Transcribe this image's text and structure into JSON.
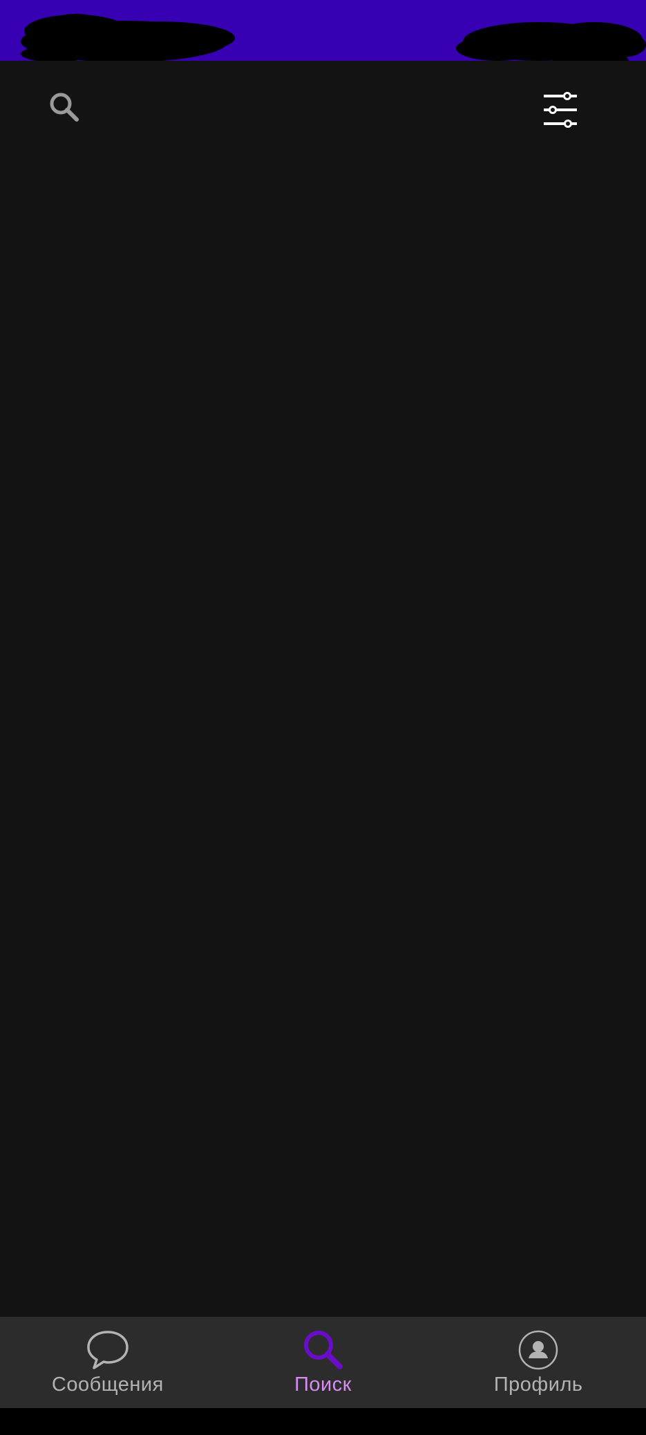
{
  "colors": {
    "status_bar": "#3700b3",
    "background": "#131313",
    "bottom_nav": "#2c2c2c",
    "system_bar": "#000000",
    "nav_inactive": "#b3b3b3",
    "nav_active_label": "#d68cf0",
    "nav_active_icon": "#6a0dc9",
    "toolbar_search_icon": "#9a9a9a",
    "toolbar_filter_icon": "#ffffff"
  },
  "toolbar": {
    "search_icon": "search-icon",
    "filter_icon": "sliders-icon"
  },
  "bottom_nav": {
    "items": [
      {
        "label": "Сообщения",
        "icon": "chat-bubble-icon",
        "active": false
      },
      {
        "label": "Поиск",
        "icon": "search-icon",
        "active": true
      },
      {
        "label": "Профиль",
        "icon": "profile-icon",
        "active": false
      }
    ]
  }
}
